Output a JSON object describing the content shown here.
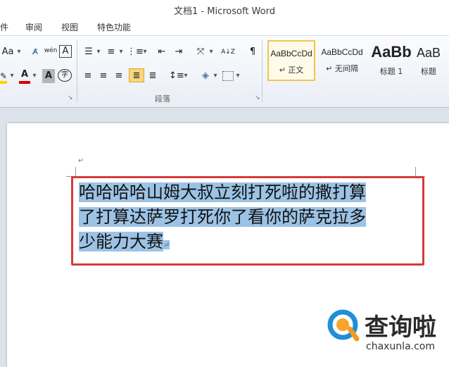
{
  "window": {
    "title": "文档1 - Microsoft Word"
  },
  "menu": {
    "tabs": [
      "件",
      "审阅",
      "视图",
      "特色功能"
    ]
  },
  "ribbon": {
    "font_group": {
      "change_case": "Aa",
      "phonetic": "wén",
      "enclosed_char": "A",
      "font_color_letter": "A",
      "char_shading_letter": "A",
      "circle_char": "字"
    },
    "paragraph_group": {
      "label": "段落",
      "sort_symbol": "A↓Z",
      "show_marks": "¶"
    },
    "styles": [
      {
        "sample": "AaBbCcDd",
        "name": "↵ 正文",
        "active": true
      },
      {
        "sample": "AaBbCcDd",
        "name": "↵ 无间隔",
        "active": false
      },
      {
        "sample": "AaBb",
        "name": "标题 1",
        "active": false
      },
      {
        "sample": "AaB",
        "name": "标题",
        "active": false
      }
    ]
  },
  "document": {
    "paragraph_mark": "↵",
    "line1": "哈哈哈哈山姆大叔立刻打死啦的撒打算",
    "line2": "了打算达萨罗打死你了看你的萨克拉多",
    "line3": "少能力大赛",
    "end_mark": "↵"
  },
  "watermark": {
    "brand": "查询啦",
    "url": "chaxunla.com"
  },
  "colors": {
    "selection": "#9cc3e5",
    "frame": "#d43c3c",
    "font_color_bar": "#d40000",
    "highlight_bar": "#ffd400"
  }
}
